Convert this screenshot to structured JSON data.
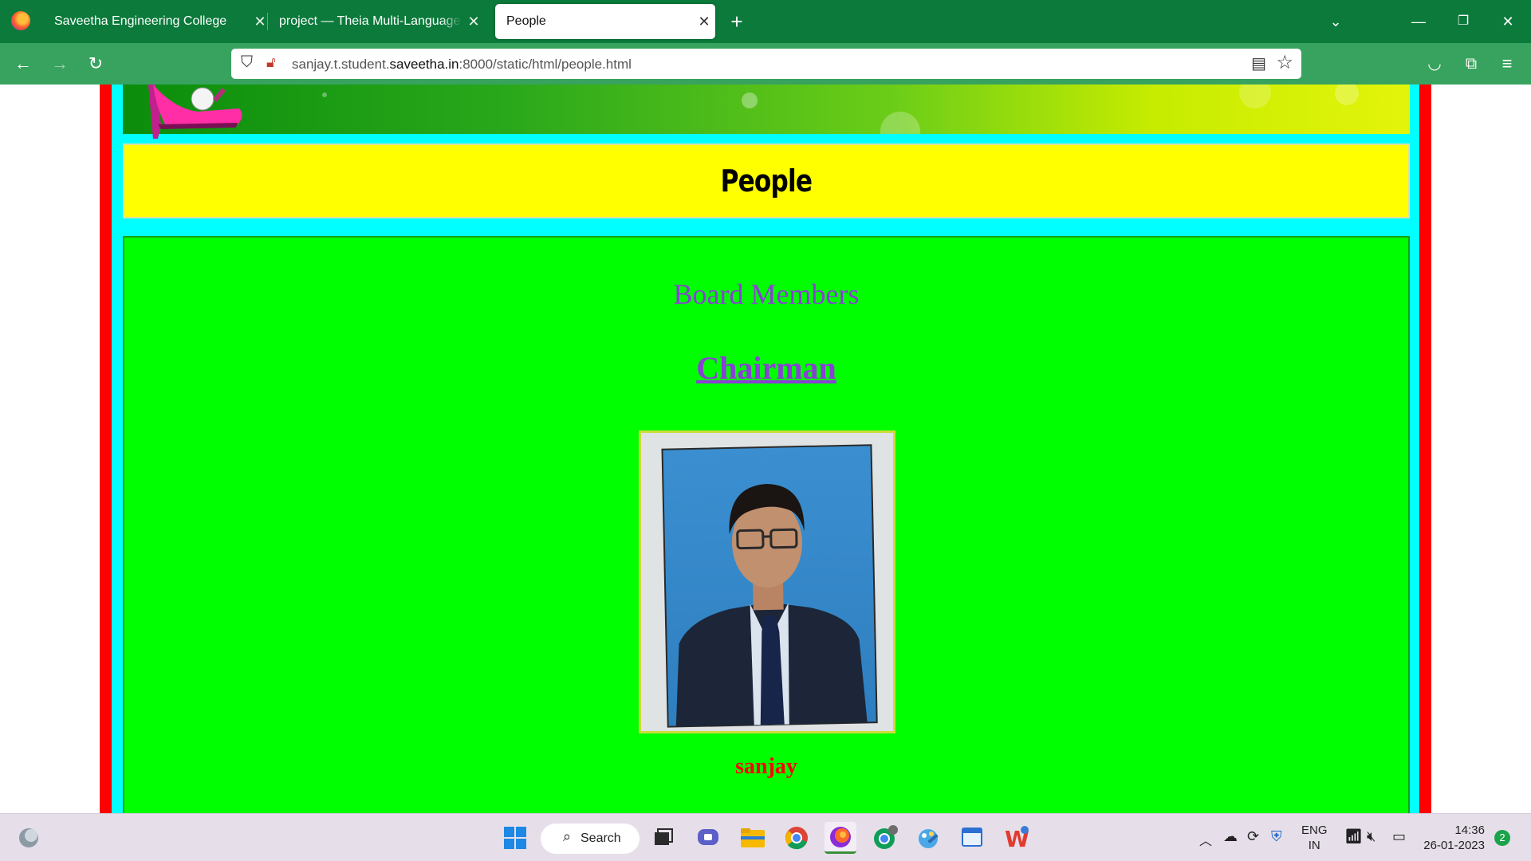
{
  "browser": {
    "tabs": [
      {
        "title": "Saveetha Engineering College",
        "active": false
      },
      {
        "title": "project — Theia Multi-Language Explorer",
        "active": false
      },
      {
        "title": "People",
        "active": true
      }
    ],
    "new_tab_icon": "plus-icon",
    "url": {
      "prefix": "sanjay.t.student.",
      "host": "saveetha.in",
      "suffix": ":8000/static/html/people.html"
    }
  },
  "page": {
    "title": "People",
    "section_heading": "Board Members",
    "role_heading": "Chairman",
    "member_name": "sanjay",
    "colors": {
      "outer_frame": "#ff0000",
      "inner_frame": "#00ffff",
      "title_bg": "#ffff00",
      "panel_bg": "#00ff00",
      "heading": "#8a3fd6",
      "name": "#ff0000"
    }
  },
  "taskbar": {
    "search_label": "Search",
    "language": {
      "line1": "ENG",
      "line2": "IN"
    },
    "time": "14:36",
    "date": "26-01-2023",
    "notification_count": "2"
  }
}
